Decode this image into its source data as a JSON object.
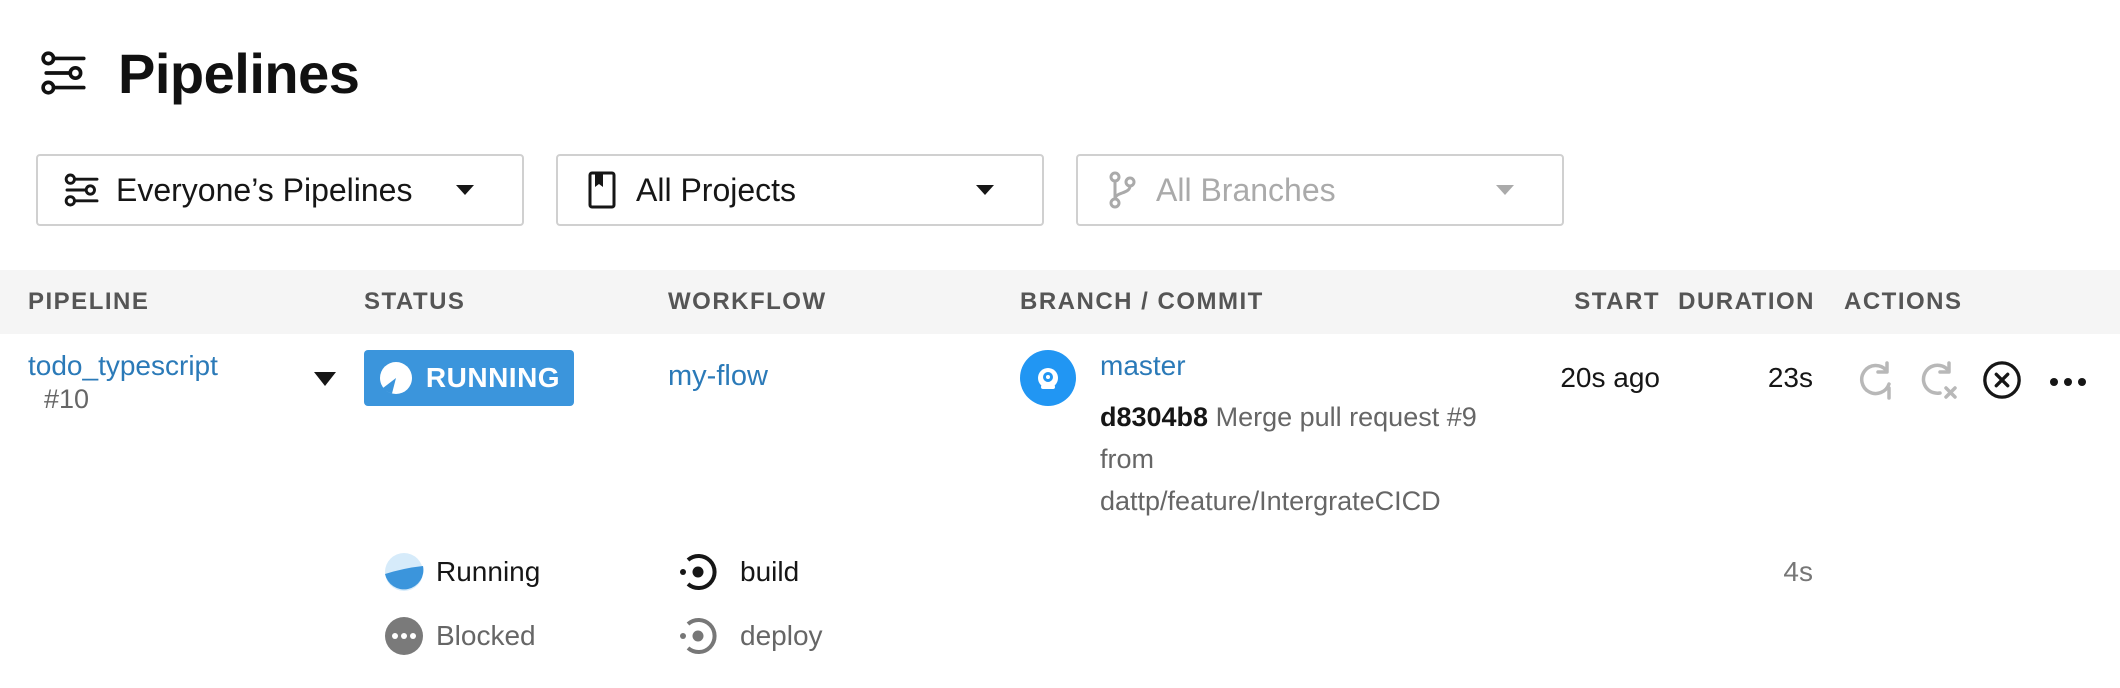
{
  "page": {
    "title": "Pipelines",
    "icon": "pipelines-icon"
  },
  "filters": [
    {
      "label": "Everyone’s Pipelines",
      "icon": "pipelines-icon",
      "enabled": true
    },
    {
      "label": "All Projects",
      "icon": "bookmark-icon",
      "enabled": true
    },
    {
      "label": "All Branches",
      "icon": "branch-icon",
      "enabled": false
    }
  ],
  "table": {
    "headers": {
      "pipeline": "PIPELINE",
      "status": "STATUS",
      "workflow": "WORKFLOW",
      "branch_commit": "BRANCH / COMMIT",
      "start": "START",
      "duration": "DURATION",
      "actions": "ACTIONS"
    },
    "rows": [
      {
        "project": "todo_typescript",
        "number": "#10",
        "status": "RUNNING",
        "workflow": "my-flow",
        "branch": "master",
        "commit_sha": "d8304b8",
        "commit_message": "Merge pull request #9 from dattp/feature/IntergrateCICD",
        "start": "20s ago",
        "duration": "23s",
        "actions": [
          "rerun-icon",
          "rerun-failed-icon",
          "cancel-icon",
          "more-icon"
        ],
        "jobs": [
          {
            "status": "Running",
            "status_icon": "running-icon",
            "name": "build",
            "duration": "4s"
          },
          {
            "status": "Blocked",
            "status_icon": "blocked-icon",
            "name": "deploy",
            "duration": ""
          }
        ]
      }
    ]
  },
  "colors": {
    "running": "#3b95dc",
    "link": "#2b7ab8",
    "header_bg": "#f5f5f5",
    "blocked": "#7a7a7a",
    "avatar": "#2196f3"
  }
}
